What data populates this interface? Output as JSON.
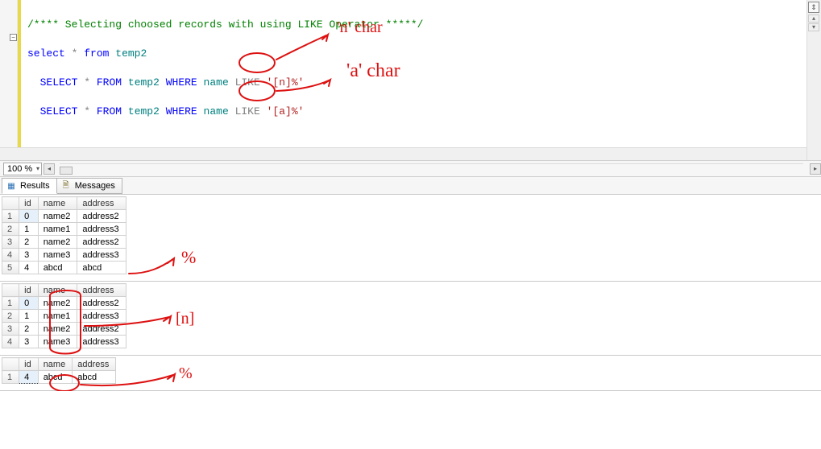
{
  "editor": {
    "comment": "/**** Selecting choosed records with using LIKE Operator *****/",
    "line_select": {
      "kw_select": "select",
      "star": "*",
      "kw_from": "from",
      "tbl": "temp2"
    },
    "line_q1": {
      "kw_select": "SELECT",
      "star": "*",
      "kw_from": "FROM",
      "tbl": "temp2",
      "kw_where": "WHERE",
      "col": "name",
      "kw_like": "LIKE",
      "lit": "'[n]%'"
    },
    "line_q2": {
      "kw_select": "SELECT",
      "star": "*",
      "kw_from": "FROM",
      "tbl": "temp2",
      "kw_where": "WHERE",
      "col": "name",
      "kw_like": "LIKE",
      "lit": "'[a]%'"
    },
    "collapse_glyph": "−",
    "sync_glyph": "⇕",
    "up_glyph": "▴",
    "down_glyph": "▾",
    "annot_n": "'n' char",
    "annot_a": "'a' char"
  },
  "zoom": {
    "value": "100 %",
    "left_glyph": "◂",
    "right_glyph": "▸"
  },
  "tabs": {
    "results": "Results",
    "messages": "Messages"
  },
  "columns": {
    "c0": "id",
    "c1": "name",
    "c2": "address"
  },
  "grids": [
    {
      "annot": "%",
      "rows": [
        {
          "n": "1",
          "id": "0",
          "name": "name2",
          "address": "address2",
          "sel": true
        },
        {
          "n": "2",
          "id": "1",
          "name": "name1",
          "address": "address3"
        },
        {
          "n": "3",
          "id": "2",
          "name": "name2",
          "address": "address2"
        },
        {
          "n": "4",
          "id": "3",
          "name": "name3",
          "address": "address3"
        },
        {
          "n": "5",
          "id": "4",
          "name": "abcd",
          "address": "abcd"
        }
      ]
    },
    {
      "annot": "[n]",
      "rows": [
        {
          "n": "1",
          "id": "0",
          "name": "name2",
          "address": "address2",
          "sel": true
        },
        {
          "n": "2",
          "id": "1",
          "name": "name1",
          "address": "address3"
        },
        {
          "n": "3",
          "id": "2",
          "name": "name2",
          "address": "address2"
        },
        {
          "n": "4",
          "id": "3",
          "name": "name3",
          "address": "address3"
        }
      ]
    },
    {
      "annot": "%",
      "rows": [
        {
          "n": "1",
          "id": "4",
          "name": "abcd",
          "address": "abcd",
          "sel": true
        }
      ]
    }
  ]
}
